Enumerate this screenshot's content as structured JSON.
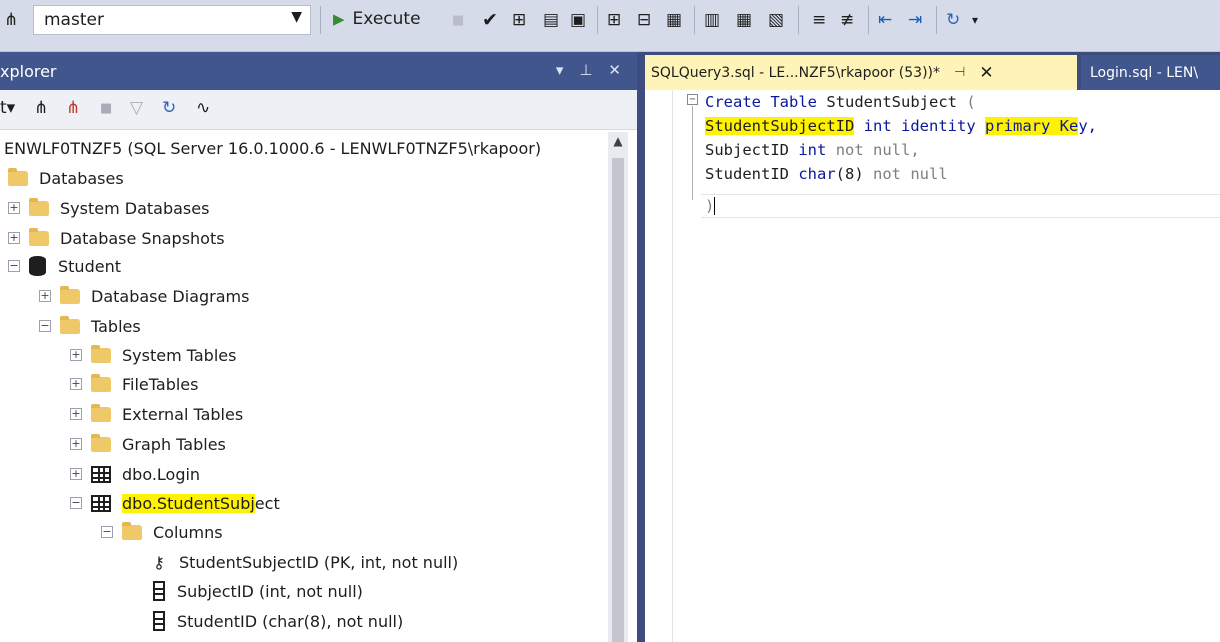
{
  "toolbar": {
    "database": "master",
    "execute_label": "Execute"
  },
  "explorer": {
    "title": "xplorer",
    "tree": {
      "server": "ENWLF0TNZF5 (SQL Server 16.0.1000.6 - LENWLF0TNZF5\\rkapoor)",
      "databases": "Databases",
      "system_databases": "System Databases",
      "database_snapshots": "Database Snapshots",
      "student": "Student",
      "database_diagrams": "Database Diagrams",
      "tables": "Tables",
      "system_tables": "System Tables",
      "file_tables": "FileTables",
      "external_tables": "External Tables",
      "graph_tables": "Graph Tables",
      "dbo_login": "dbo.Login",
      "dbo_studentsubject_hl": "dbo.StudentSubj",
      "dbo_studentsubject_rest": "ect",
      "columns": "Columns",
      "col_1": "StudentSubjectID (PK, int, not null)",
      "col_2": "SubjectID (int, not null)",
      "col_3": "StudentID (char(8), not null)"
    }
  },
  "editor": {
    "active_tab": "SQLQuery3.sql - LE...NZF5\\rkapoor (53))*",
    "other_tab": "Login.sql - LEN\\",
    "code": {
      "l1_kw1": "Create",
      "l1_kw2": "Table",
      "l1_name": "StudentSubject",
      "l1_paren": "(",
      "l2_col_hl": "StudentSubjectID",
      "l2_type": "int",
      "l2_kw": "identity",
      "l2_pk_hl": "primary Ke",
      "l2_tail": "y,",
      "l3_col": "SubjectID",
      "l3_type": "int",
      "l3_null": "not null,",
      "l4_col": "StudentID",
      "l4_type": "char",
      "l4_arg": "(8)",
      "l4_null": "not null",
      "l5_close": ")"
    }
  }
}
